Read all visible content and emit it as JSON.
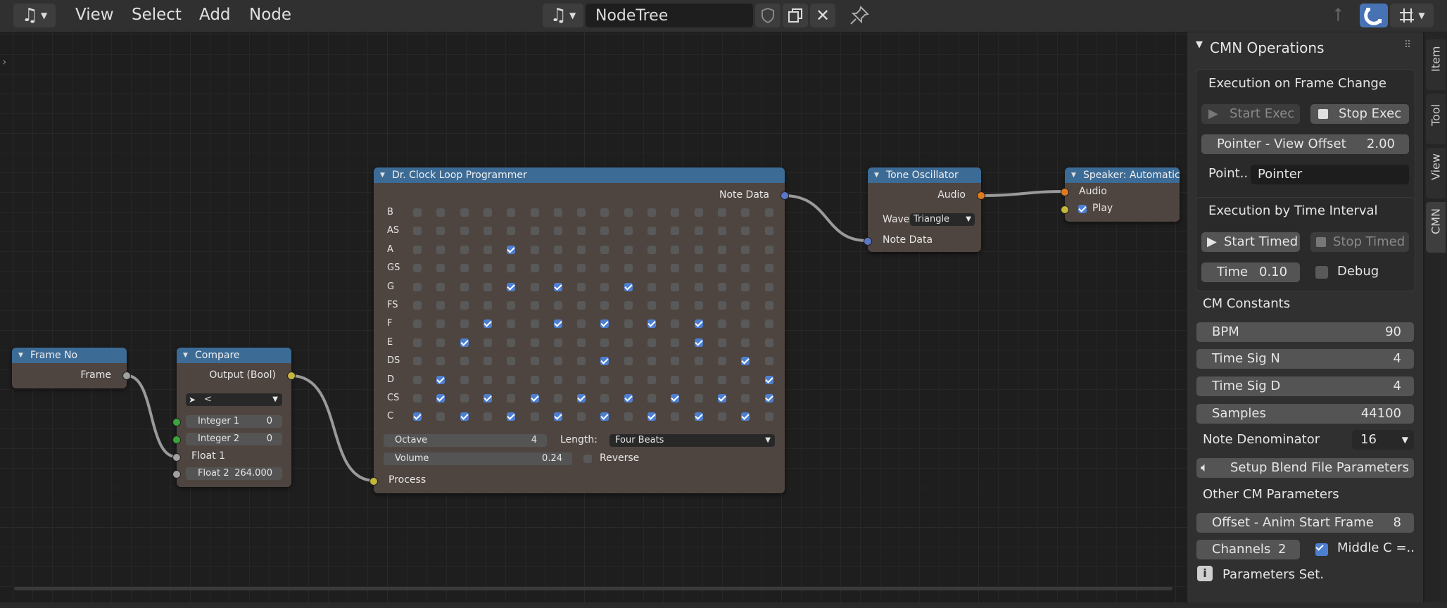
{
  "header": {
    "menus": [
      "View",
      "Select",
      "Add",
      "Node"
    ],
    "tree_name": "NodeTree"
  },
  "nodes": {
    "frame_no": {
      "title": "Frame No",
      "output": "Frame"
    },
    "compare": {
      "title": "Compare",
      "output": "Output (Bool)",
      "operator": "<",
      "integer1_label": "Integer 1",
      "integer1_value": "0",
      "integer2_label": "Integer 2",
      "integer2_value": "0",
      "float1_label": "Float 1",
      "float2_label": "Float 2",
      "float2_value": "264.000"
    },
    "loop": {
      "title": "Dr. Clock Loop Programmer",
      "output": "Note Data",
      "notes": [
        "B",
        "AS",
        "A",
        "GS",
        "G",
        "FS",
        "F",
        "E",
        "DS",
        "D",
        "CS",
        "C"
      ],
      "grid": [
        "0000000000000000",
        "0000000000000000",
        "0000100000000000",
        "0000000000000000",
        "0000101001000000",
        "0000000000000000",
        "0001001010101000",
        "0010000000001000",
        "0000000010000010",
        "0100000000000001",
        "0101010101010101",
        "1010101010101010"
      ],
      "octave_label": "Octave",
      "octave_value": "4",
      "length_label": "Length:",
      "length_value": "Four Beats",
      "volume_label": "Volume",
      "volume_value": "0.24",
      "reverse_label": "Reverse",
      "input": "Process"
    },
    "oscillator": {
      "title": "Tone Oscillator",
      "output": "Audio",
      "wave_label": "Wave",
      "wave_value": "Triangle",
      "input": "Note Data"
    },
    "speaker": {
      "title": "Speaker: Automatic",
      "input1": "Audio",
      "play_label": "Play"
    }
  },
  "panel": {
    "title": "CMN Operations",
    "frame_change_title": "Execution on Frame Change",
    "start_exec": "Start Exec",
    "stop_exec": "Stop Exec",
    "view_offset_label": "Pointer - View Offset",
    "view_offset_value": "2.00",
    "point_label": "Point..",
    "point_value": "Pointer",
    "time_interval_title": "Execution by Time Interval",
    "start_timed": "Start Timed",
    "stop_timed": "Stop Timed",
    "time_label": "Time",
    "time_value": "0.10",
    "debug_label": "Debug",
    "constants_title": "CM Constants",
    "bpm_label": "BPM",
    "bpm_value": "90",
    "sig_n_label": "Time Sig N",
    "sig_n_value": "4",
    "sig_d_label": "Time Sig D",
    "sig_d_value": "4",
    "samples_label": "Samples",
    "samples_value": "44100",
    "note_denom_label": "Note Denominator",
    "note_denom_value": "16",
    "setup_button": "Setup Blend File Parameters",
    "other_title": "Other CM Parameters",
    "offset_label": "Offset - Anim Start Frame",
    "offset_value": "8",
    "channels_label": "Channels",
    "channels_value": "2",
    "middle_c_label": "Middle C =..",
    "status": "Parameters Set."
  },
  "tabs": [
    "Item",
    "Tool",
    "View",
    "CMN"
  ],
  "colors": {
    "node_header": "#3c6b96",
    "node_body": "#4f4540",
    "checkbox_on": "#4d7fd1",
    "accent": "#4772b3"
  }
}
